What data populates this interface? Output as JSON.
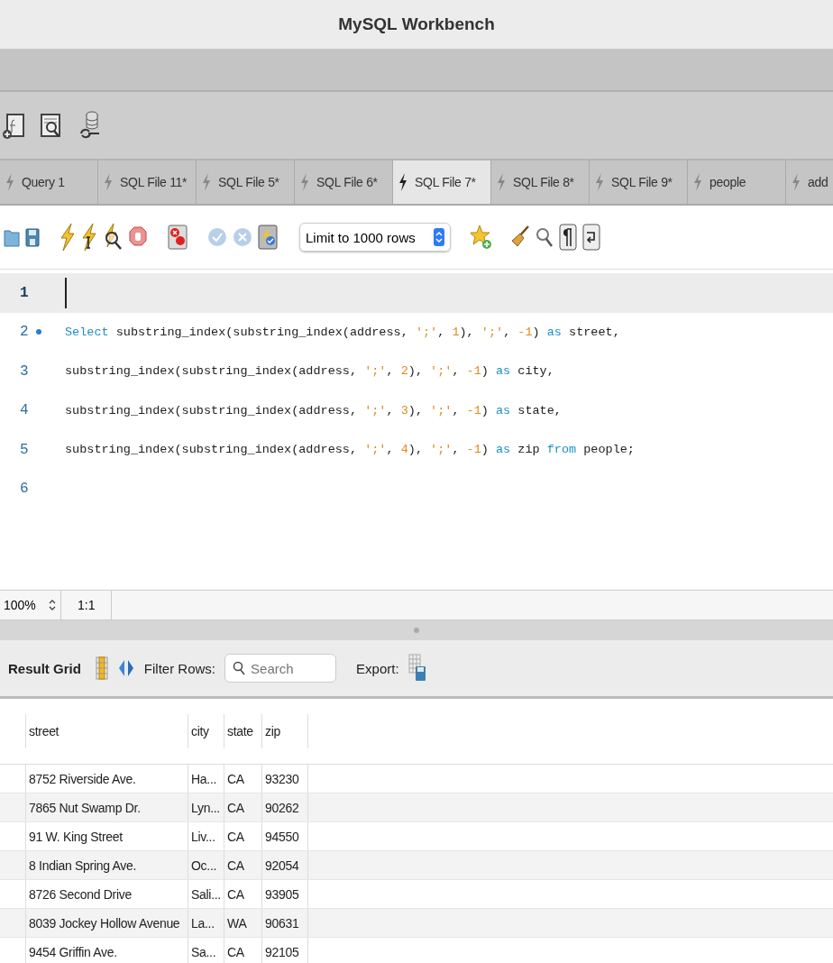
{
  "window": {
    "title": "MySQL Workbench"
  },
  "tabs": [
    {
      "label": "Query 1",
      "selected": false
    },
    {
      "label": "SQL File 11*",
      "selected": false
    },
    {
      "label": "SQL File 5*",
      "selected": false
    },
    {
      "label": "SQL File 6*",
      "selected": false
    },
    {
      "label": "SQL File 7*",
      "selected": true
    },
    {
      "label": "SQL File 8*",
      "selected": false
    },
    {
      "label": "SQL File 9*",
      "selected": false
    },
    {
      "label": "people",
      "selected": false
    },
    {
      "label": "add",
      "selected": false
    }
  ],
  "limit_dropdown": {
    "value": "Limit to 1000 rows"
  },
  "editor": {
    "lines": [
      {
        "number": "1",
        "current": true,
        "marker": false
      },
      {
        "number": "2",
        "current": false,
        "marker": true,
        "tokens": [
          {
            "kind": "keyword",
            "text": "Select"
          },
          {
            "kind": "plain",
            "text": " substring_index(substring_index(address, "
          },
          {
            "kind": "string",
            "text": "';'"
          },
          {
            "kind": "plain",
            "text": ", "
          },
          {
            "kind": "number",
            "text": "1"
          },
          {
            "kind": "plain",
            "text": "), "
          },
          {
            "kind": "string",
            "text": "';'"
          },
          {
            "kind": "plain",
            "text": ", "
          },
          {
            "kind": "number",
            "text": "-1"
          },
          {
            "kind": "plain",
            "text": ") "
          },
          {
            "kind": "keyword",
            "text": "as"
          },
          {
            "kind": "plain",
            "text": " street,"
          }
        ]
      },
      {
        "number": "3",
        "current": false,
        "marker": false,
        "tokens": [
          {
            "kind": "plain",
            "text": "substring_index(substring_index(address, "
          },
          {
            "kind": "string",
            "text": "';'"
          },
          {
            "kind": "plain",
            "text": ", "
          },
          {
            "kind": "number",
            "text": "2"
          },
          {
            "kind": "plain",
            "text": "), "
          },
          {
            "kind": "string",
            "text": "';'"
          },
          {
            "kind": "plain",
            "text": ", "
          },
          {
            "kind": "number",
            "text": "-1"
          },
          {
            "kind": "plain",
            "text": ") "
          },
          {
            "kind": "keyword",
            "text": "as"
          },
          {
            "kind": "plain",
            "text": " city,"
          }
        ]
      },
      {
        "number": "4",
        "current": false,
        "marker": false,
        "tokens": [
          {
            "kind": "plain",
            "text": "substring_index(substring_index(address, "
          },
          {
            "kind": "string",
            "text": "';'"
          },
          {
            "kind": "plain",
            "text": ", "
          },
          {
            "kind": "number",
            "text": "3"
          },
          {
            "kind": "plain",
            "text": "), "
          },
          {
            "kind": "string",
            "text": "';'"
          },
          {
            "kind": "plain",
            "text": ", "
          },
          {
            "kind": "number",
            "text": "-1"
          },
          {
            "kind": "plain",
            "text": ") "
          },
          {
            "kind": "keyword",
            "text": "as"
          },
          {
            "kind": "plain",
            "text": " state,"
          }
        ]
      },
      {
        "number": "5",
        "current": false,
        "marker": false,
        "tokens": [
          {
            "kind": "plain",
            "text": "substring_index(substring_index(address, "
          },
          {
            "kind": "string",
            "text": "';'"
          },
          {
            "kind": "plain",
            "text": ", "
          },
          {
            "kind": "number",
            "text": "4"
          },
          {
            "kind": "plain",
            "text": "), "
          },
          {
            "kind": "string",
            "text": "';'"
          },
          {
            "kind": "plain",
            "text": ", "
          },
          {
            "kind": "number",
            "text": "-1"
          },
          {
            "kind": "plain",
            "text": ") "
          },
          {
            "kind": "keyword",
            "text": "as"
          },
          {
            "kind": "plain",
            "text": " zip "
          },
          {
            "kind": "keyword",
            "text": "from"
          },
          {
            "kind": "plain",
            "text": " people;"
          }
        ]
      },
      {
        "number": "6",
        "current": false,
        "marker": false
      }
    ]
  },
  "status_bar": {
    "zoom": "100%",
    "position": "1:1"
  },
  "result_toolbar": {
    "title": "Result Grid",
    "filter_label": "Filter Rows:",
    "search_placeholder": "Search",
    "export_label": "Export:"
  },
  "table": {
    "columns": [
      "street",
      "city",
      "state",
      "zip"
    ],
    "rows": [
      [
        "8752 Riverside Ave.",
        "Ha...",
        "CA",
        "93230"
      ],
      [
        "7865 Nut Swamp Dr.",
        "Lyn...",
        "CA",
        "90262"
      ],
      [
        "91 W. King Street",
        " Liv...",
        "CA",
        "94550"
      ],
      [
        "8 Indian Spring Ave.",
        "Oc...",
        "CA",
        "92054"
      ],
      [
        "8726 Second Drive",
        "Sali...",
        "CA",
        "93905"
      ],
      [
        "8039 Jockey Hollow Avenue",
        "La...",
        "WA",
        "90631"
      ],
      [
        "9454 Griffin Ave.",
        "Sa...",
        "CA",
        "92105"
      ]
    ]
  }
}
